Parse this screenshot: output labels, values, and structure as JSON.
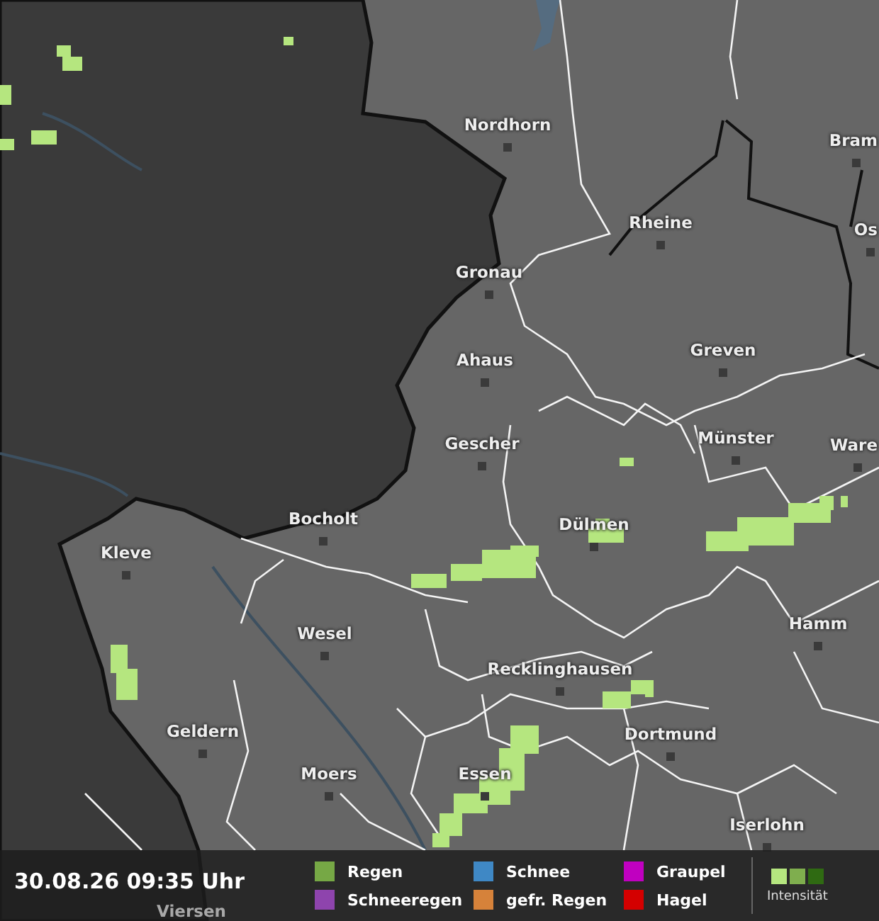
{
  "map": {
    "cities": [
      {
        "name": "Nordhorn"
      },
      {
        "name": "Bram"
      },
      {
        "name": "Rheine"
      },
      {
        "name": "Os"
      },
      {
        "name": "Gronau"
      },
      {
        "name": "Greven"
      },
      {
        "name": "Ahaus"
      },
      {
        "name": "Gescher"
      },
      {
        "name": "Münster"
      },
      {
        "name": "Ware"
      },
      {
        "name": "Bocholt"
      },
      {
        "name": "Dülmen"
      },
      {
        "name": "Kleve"
      },
      {
        "name": "Wesel"
      },
      {
        "name": "Hamm"
      },
      {
        "name": "Recklinghausen"
      },
      {
        "name": "Geldern"
      },
      {
        "name": "Dortmund"
      },
      {
        "name": "Moers"
      },
      {
        "name": "Essen"
      },
      {
        "name": "Iserlohn"
      },
      {
        "name": "Viersen"
      }
    ]
  },
  "status_bar": {
    "timestamp": "30.08.26 09:35 Uhr",
    "legend": [
      {
        "label": "Regen",
        "color": "#76a845"
      },
      {
        "label": "Schnee",
        "color": "#3f88c5"
      },
      {
        "label": "Graupel",
        "color": "#c000c0"
      },
      {
        "label": "Schneeregen",
        "color": "#8e44ad"
      },
      {
        "label": "gefr. Regen",
        "color": "#d6823a"
      },
      {
        "label": "Hagel",
        "color": "#d40000"
      }
    ],
    "intensity": {
      "label": "Intensität",
      "swatches": [
        {
          "color": "#b5e67f"
        },
        {
          "color": "#7fae4e"
        },
        {
          "color": "#2f6a12"
        }
      ]
    }
  }
}
